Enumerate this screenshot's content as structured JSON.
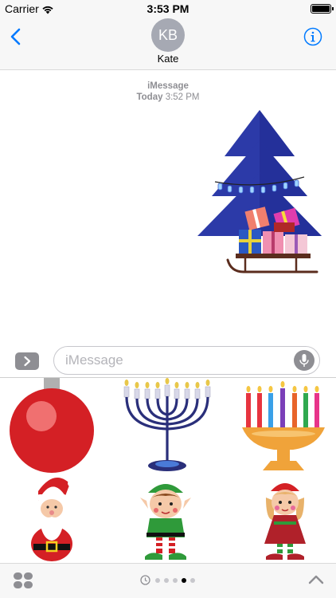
{
  "status_bar": {
    "carrier": "Carrier",
    "time": "3:53 PM",
    "battery_level": 1.0
  },
  "nav": {
    "back_icon": "chevron-left-icon",
    "avatar_initials": "KB",
    "contact_name": "Kate",
    "info_icon": "info-icon",
    "accent_color": "#007aff"
  },
  "conversation": {
    "service": "iMessage",
    "day": "Today",
    "time": "3:52 PM",
    "sent_sticker": "christmas-tree-sleigh-sticker"
  },
  "input": {
    "placeholder": "iMessage",
    "value": "",
    "expand_icon": "chevron-right-icon",
    "mic_icon": "microphone-icon"
  },
  "sticker_drawer": {
    "stickers": [
      "red-ornament-sticker",
      "menorah-sticker",
      "kinara-sticker",
      "santa-sticker",
      "boy-elf-sticker",
      "girl-elf-sticker"
    ]
  },
  "drawer_toolbar": {
    "apps_icon": "app-drawer-icon",
    "recent_icon": "clock-icon",
    "page_count": 5,
    "active_page": 4,
    "collapse_icon": "chevron-up-icon"
  }
}
